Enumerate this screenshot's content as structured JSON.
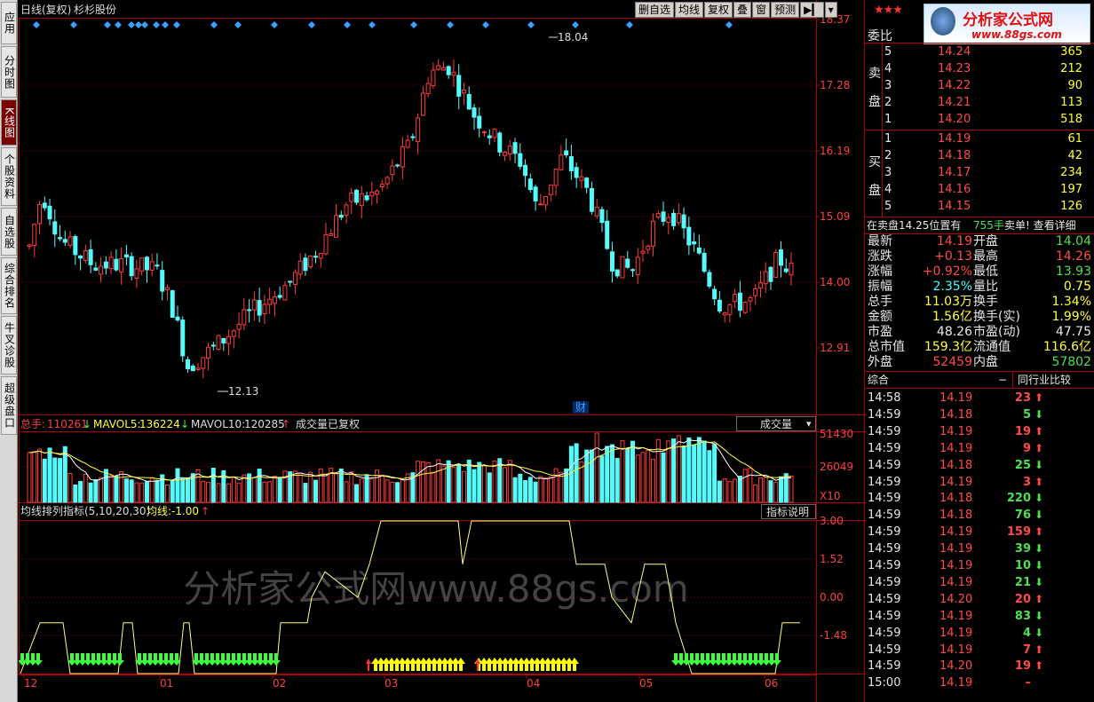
{
  "left_tabs": [
    {
      "label": "应用",
      "active": false
    },
    {
      "label": "分时图",
      "active": false
    },
    {
      "label": "K线图",
      "active": true
    },
    {
      "label": "个股资料",
      "active": false
    },
    {
      "label": "自选股",
      "active": false
    },
    {
      "label": "综合排名",
      "active": false
    },
    {
      "label": "牛叉诊股",
      "active": false
    },
    {
      "label": "超级盘口",
      "active": false
    }
  ],
  "chart_header": {
    "title": "日线(复权)",
    "stock_name": "杉杉股份"
  },
  "toolbar": [
    "删自选",
    "均线",
    "复权",
    "叠",
    "窗",
    "预测"
  ],
  "price_axis": [
    "18.37",
    "17.28",
    "16.19",
    "15.09",
    "14.00",
    "12.91"
  ],
  "annotations": {
    "high": "18.04",
    "low": "12.13",
    "fin_marker": "财"
  },
  "volume_panel": {
    "label_total": "总手:",
    "total": "110261",
    "label_ma5": "MAVOL5:",
    "ma5": "136224",
    "label_ma10": "MAVOL10:",
    "ma10": "120285",
    "note": "成交量已复权",
    "dropdown": "成交量",
    "axis": [
      "51430",
      "26049"
    ],
    "unit": "X10"
  },
  "indicator_panel": {
    "title": "均线排列指标(5,10,20,30)",
    "value_label": "均线:",
    "value": "-1.00",
    "button": "指标说明",
    "axis": [
      "3.00",
      "1.52",
      "0.00",
      "-1.48"
    ]
  },
  "x_axis": [
    "12",
    "01",
    "02",
    "03",
    "04",
    "05",
    "06"
  ],
  "watermark": "分析家公式网www.88gs.com",
  "right_panel": {
    "stars": "★★★",
    "logo_main": "分析家公式网",
    "logo_url": "www.88gs.com",
    "weibi_label": "委比",
    "sell_label": [
      "卖",
      "盘"
    ],
    "buy_label": [
      "买",
      "盘"
    ],
    "sell_orders": [
      {
        "level": "5",
        "price": "14.24",
        "vol": "365"
      },
      {
        "level": "4",
        "price": "14.23",
        "vol": "212"
      },
      {
        "level": "3",
        "price": "14.22",
        "vol": "90"
      },
      {
        "level": "2",
        "price": "14.21",
        "vol": "113"
      },
      {
        "level": "1",
        "price": "14.20",
        "vol": "518"
      }
    ],
    "buy_orders": [
      {
        "level": "1",
        "price": "14.19",
        "vol": "61"
      },
      {
        "level": "2",
        "price": "14.18",
        "vol": "42"
      },
      {
        "level": "3",
        "price": "14.17",
        "vol": "234"
      },
      {
        "level": "4",
        "price": "14.16",
        "vol": "197"
      },
      {
        "level": "5",
        "price": "14.15",
        "vol": "126"
      }
    ],
    "notice": {
      "text": "在卖盘14.25位置有",
      "vol": "755手",
      "tail": "卖单! 查看详细"
    },
    "quote_rows": [
      {
        "l1": "最新",
        "v1": "14.19",
        "c1": "red",
        "l2": "开盘",
        "v2": "14.04",
        "c2": "green"
      },
      {
        "l1": "涨跌",
        "v1": "+0.13",
        "c1": "red",
        "l2": "最高",
        "v2": "14.26",
        "c2": "red"
      },
      {
        "l1": "涨幅",
        "v1": "+0.92%",
        "c1": "red",
        "l2": "最低",
        "v2": "13.93",
        "c2": "green"
      },
      {
        "l1": "振幅",
        "v1": "2.35%",
        "c1": "cyan",
        "l2": "量比",
        "v2": "0.75",
        "c2": "yellow"
      },
      {
        "l1": "总手",
        "v1": "11.03万",
        "c1": "yellow",
        "l2": "换手",
        "v2": "1.34%",
        "c2": "yellow"
      },
      {
        "l1": "金额",
        "v1": "1.56亿",
        "c1": "yellow",
        "l2": "换手(实)",
        "v2": "1.99%",
        "c2": "yellow"
      },
      {
        "l1": "市盈",
        "v1": "48.26",
        "c1": "white",
        "l2": "市盈(动)",
        "v2": "47.75",
        "c2": "white"
      },
      {
        "l1": "总市值",
        "v1": "159.3亿",
        "c1": "yellow",
        "l2": "流通值",
        "v2": "116.6亿",
        "c2": "yellow"
      },
      {
        "l1": "外盘",
        "v1": "52459",
        "c1": "red",
        "l2": "内盘",
        "v2": "57802",
        "c2": "green"
      }
    ],
    "tabs": {
      "left": "综合",
      "minus": "−",
      "right": "同行业比较"
    },
    "ticks": [
      {
        "t": "14:58",
        "p": "14.19",
        "v": "23",
        "d": "up"
      },
      {
        "t": "14:59",
        "p": "14.18",
        "v": "5",
        "d": "down"
      },
      {
        "t": "14:59",
        "p": "14.19",
        "v": "19",
        "d": "up"
      },
      {
        "t": "14:59",
        "p": "14.19",
        "v": "9",
        "d": "up"
      },
      {
        "t": "14:59",
        "p": "14.18",
        "v": "25",
        "d": "down"
      },
      {
        "t": "14:59",
        "p": "14.19",
        "v": "3",
        "d": "up"
      },
      {
        "t": "14:59",
        "p": "14.18",
        "v": "220",
        "d": "down"
      },
      {
        "t": "14:59",
        "p": "14.18",
        "v": "76",
        "d": "down"
      },
      {
        "t": "14:59",
        "p": "14.19",
        "v": "159",
        "d": "up"
      },
      {
        "t": "14:59",
        "p": "14.19",
        "v": "39",
        "d": "down"
      },
      {
        "t": "14:59",
        "p": "14.19",
        "v": "10",
        "d": "down"
      },
      {
        "t": "14:59",
        "p": "14.19",
        "v": "21",
        "d": "down"
      },
      {
        "t": "14:59",
        "p": "14.20",
        "v": "20",
        "d": "up"
      },
      {
        "t": "14:59",
        "p": "14.19",
        "v": "83",
        "d": "down"
      },
      {
        "t": "14:59",
        "p": "14.19",
        "v": "4",
        "d": "down"
      },
      {
        "t": "14:59",
        "p": "14.19",
        "v": "7",
        "d": "up"
      },
      {
        "t": "14:59",
        "p": "14.20",
        "v": "19",
        "d": "up"
      },
      {
        "t": "15:00",
        "p": "14.19",
        "v": "–",
        "d": "none"
      }
    ]
  },
  "colors": {
    "up": "#ff3b3b",
    "down": "#54fcfc",
    "grid": "#8a0000",
    "buy_arrow": "#3cff3c",
    "sell_arrow": "#ffff00"
  }
}
